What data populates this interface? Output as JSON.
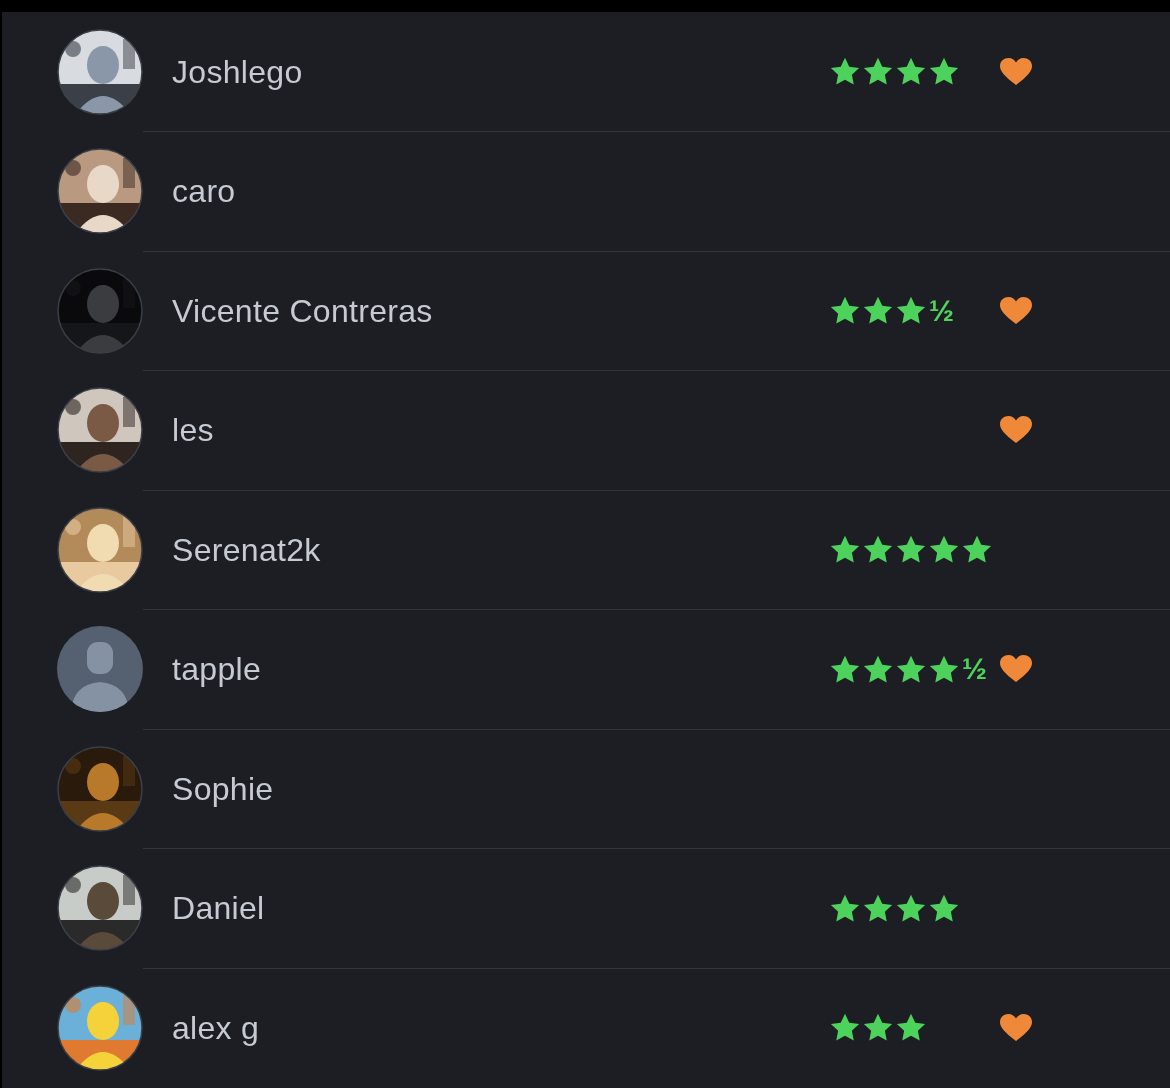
{
  "rows": [
    {
      "name": "Joshlego",
      "stars": 4,
      "liked": true
    },
    {
      "name": "caro",
      "liked": false
    },
    {
      "name": "Vicente Contreras",
      "stars": 3,
      "half_mark": "½",
      "liked": true
    },
    {
      "name": "les",
      "liked": true
    },
    {
      "name": "Serenat2k",
      "stars": 5,
      "liked": false
    },
    {
      "name": "tapple",
      "avatar": {
        "kind": "default"
      },
      "stars": 4,
      "half_mark": "½",
      "liked": true
    },
    {
      "name": "Sophie",
      "liked": false
    },
    {
      "name": "Daniel",
      "stars": 4,
      "liked": false
    },
    {
      "name": "alex g",
      "stars": 3,
      "liked": true
    }
  ]
}
